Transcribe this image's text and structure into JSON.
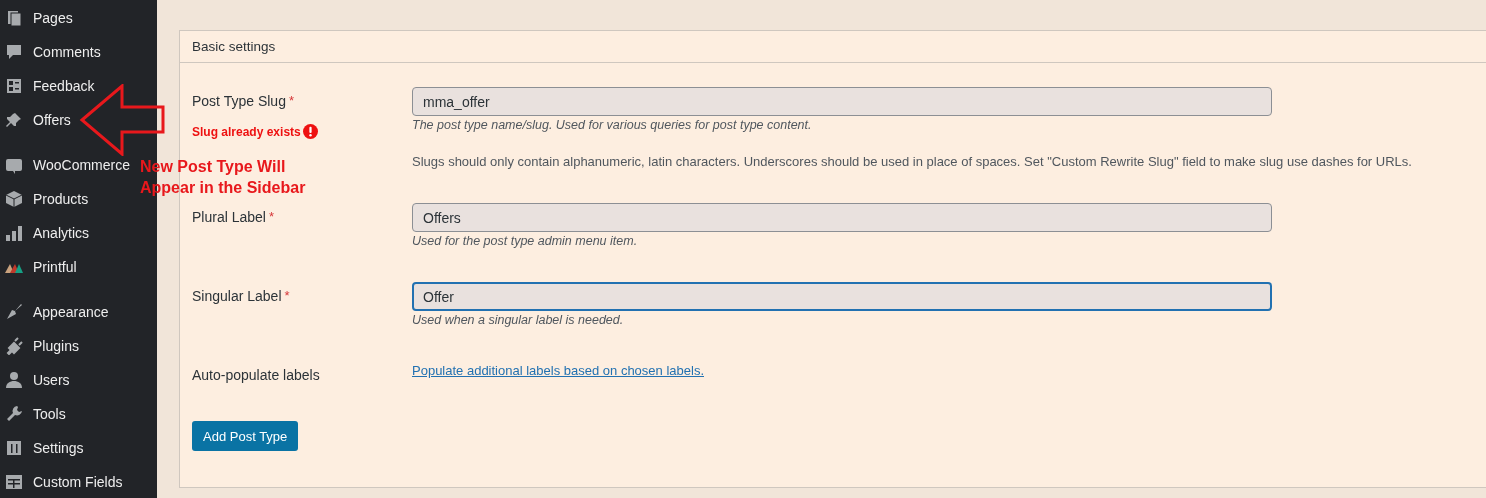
{
  "sidebar": {
    "groups": [
      {
        "items": [
          {
            "label": "Pages",
            "selected": false
          },
          {
            "label": "Comments",
            "selected": false
          },
          {
            "label": "Feedback",
            "selected": false
          },
          {
            "label": "Offers",
            "selected": false
          }
        ]
      },
      {
        "items": [
          {
            "label": "WooCommerce",
            "selected": false
          },
          {
            "label": "Products",
            "selected": false
          },
          {
            "label": "Analytics",
            "selected": false
          },
          {
            "label": "Printful",
            "selected": false
          }
        ]
      },
      {
        "items": [
          {
            "label": "Appearance",
            "selected": false
          },
          {
            "label": "Plugins",
            "selected": false
          },
          {
            "label": "Users",
            "selected": false
          },
          {
            "label": "Tools",
            "selected": false
          },
          {
            "label": "Settings",
            "selected": false
          },
          {
            "label": "Custom Fields",
            "selected": false
          }
        ]
      }
    ]
  },
  "annotation": {
    "text": "New Post Type Will Appear in the Sidebar"
  },
  "panel": {
    "title": "Basic settings",
    "rows": [
      {
        "kind": "field",
        "label": "Post Type Slug",
        "required_mark": "*",
        "error": "Slug already exists",
        "value": "mma_offer",
        "focused": false,
        "help": "The post type name/slug. Used for various queries for post type content.",
        "note": "Slugs should only contain alphanumeric, latin characters. Underscores should be used in place of spaces. Set \"Custom Rewrite Slug\" field to make slug use dashes for URLs."
      },
      {
        "kind": "field",
        "label": "Plural Label",
        "required_mark": "*",
        "value": "Offers",
        "focused": false,
        "help": "Used for the post type admin menu item."
      },
      {
        "kind": "field",
        "label": "Singular Label",
        "required_mark": "*",
        "value": "Offer",
        "focused": true,
        "help": "Used when a singular label is needed."
      },
      {
        "kind": "link",
        "label": "Auto-populate labels",
        "link": "Populate additional labels based on chosen labels."
      }
    ],
    "button": "Add Post Type"
  }
}
